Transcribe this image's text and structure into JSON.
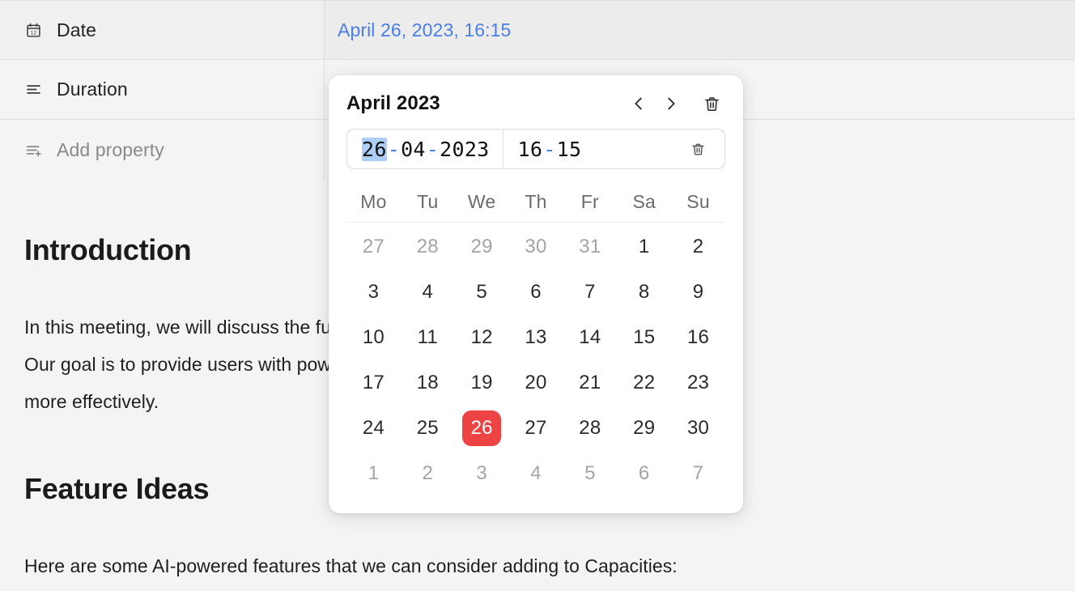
{
  "properties": [
    {
      "icon": "calendar-12-icon",
      "label": "Date",
      "value": "April 26, 2023, 16:15",
      "muted": false,
      "highlight": true
    },
    {
      "icon": "text-lines-icon",
      "label": "Duration",
      "value": "",
      "muted": false,
      "highlight": false
    },
    {
      "icon": "add-lines-icon",
      "label": "Add property",
      "value": "",
      "muted": true,
      "highlight": false
    }
  ],
  "document": {
    "intro_heading": "Introduction",
    "intro_paragraph": "In this meeting, we will discuss the future of Capacities, our note-taking and\nOur goal is to provide users with powerful tools that help them organize and use their k\nmore effectively.",
    "features_heading": "Feature Ideas",
    "features_paragraph": "Here are some AI-powered features that we can consider adding to Capacities:"
  },
  "calendar": {
    "title": "April 2023",
    "prev_label": "‹",
    "next_label": "›",
    "date_input": {
      "day": "26",
      "month": "04",
      "year": "2023",
      "separator": "-",
      "selected_segment": "day"
    },
    "time_input": {
      "hours": "16",
      "minutes": "15",
      "separator": "-"
    },
    "weekdays": [
      "Mo",
      "Tu",
      "We",
      "Th",
      "Fr",
      "Sa",
      "Su"
    ],
    "selected_day": 26,
    "accent_selected_color": "#ee4343",
    "accent_link_color": "#4a7fe8",
    "selection_highlight_color": "#accef7",
    "weeks": [
      [
        {
          "n": "27",
          "out": true
        },
        {
          "n": "28",
          "out": true
        },
        {
          "n": "29",
          "out": true
        },
        {
          "n": "30",
          "out": true
        },
        {
          "n": "31",
          "out": true
        },
        {
          "n": "1",
          "out": false
        },
        {
          "n": "2",
          "out": false
        }
      ],
      [
        {
          "n": "3",
          "out": false
        },
        {
          "n": "4",
          "out": false
        },
        {
          "n": "5",
          "out": false
        },
        {
          "n": "6",
          "out": false
        },
        {
          "n": "7",
          "out": false
        },
        {
          "n": "8",
          "out": false
        },
        {
          "n": "9",
          "out": false
        }
      ],
      [
        {
          "n": "10",
          "out": false
        },
        {
          "n": "11",
          "out": false
        },
        {
          "n": "12",
          "out": false
        },
        {
          "n": "13",
          "out": false
        },
        {
          "n": "14",
          "out": false
        },
        {
          "n": "15",
          "out": false
        },
        {
          "n": "16",
          "out": false
        }
      ],
      [
        {
          "n": "17",
          "out": false
        },
        {
          "n": "18",
          "out": false
        },
        {
          "n": "19",
          "out": false
        },
        {
          "n": "20",
          "out": false
        },
        {
          "n": "21",
          "out": false
        },
        {
          "n": "22",
          "out": false
        },
        {
          "n": "23",
          "out": false
        }
      ],
      [
        {
          "n": "24",
          "out": false
        },
        {
          "n": "25",
          "out": false
        },
        {
          "n": "26",
          "out": false,
          "selected": true
        },
        {
          "n": "27",
          "out": false
        },
        {
          "n": "28",
          "out": false
        },
        {
          "n": "29",
          "out": false
        },
        {
          "n": "30",
          "out": false
        }
      ],
      [
        {
          "n": "1",
          "out": true
        },
        {
          "n": "2",
          "out": true
        },
        {
          "n": "3",
          "out": true
        },
        {
          "n": "4",
          "out": true
        },
        {
          "n": "5",
          "out": true
        },
        {
          "n": "6",
          "out": true
        },
        {
          "n": "7",
          "out": true
        }
      ]
    ]
  }
}
